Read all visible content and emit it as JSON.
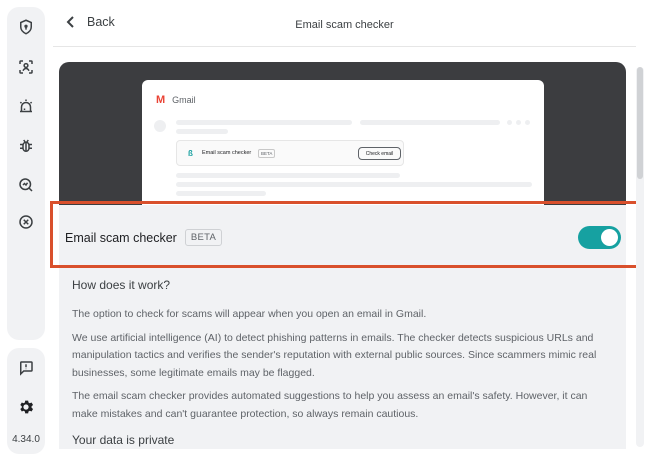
{
  "header": {
    "back_label": "Back",
    "title": "Email scam checker"
  },
  "sidebar": {
    "items": [
      {
        "icon": "shield-icon"
      },
      {
        "icon": "face-scan-icon"
      },
      {
        "icon": "alarm-icon"
      },
      {
        "icon": "bug-icon"
      },
      {
        "icon": "magnifier-chart-icon"
      },
      {
        "icon": "block-icon"
      }
    ],
    "bottom": [
      {
        "icon": "feedback-icon"
      },
      {
        "icon": "gear-icon"
      }
    ],
    "version": "4.34.0"
  },
  "preview": {
    "gmail_label": "Gmail",
    "card_label": "Email scam checker",
    "card_badge": "BETA",
    "card_button": "Check email"
  },
  "feature": {
    "label": "Email scam checker",
    "badge": "BETA",
    "enabled": true,
    "accent_color": "#16a1a1"
  },
  "faq": {
    "heading": "How does it work?",
    "paragraphs": [
      "The option to check for scams will appear when you open an email in Gmail.",
      "We use artificial intelligence (AI) to detect phishing patterns in emails. The checker detects suspicious URLs and manipulation tactics and verifies the sender's reputation with external public sources. Since scammers mimic real businesses, some legitimate emails may be flagged.",
      "The email scam checker provides automated suggestions to help you assess an email's safety. However, it can make mistakes and can't guarantee protection, so always remain cautious."
    ],
    "heading2": "Your data is private"
  },
  "highlight_color": "#d9502c"
}
